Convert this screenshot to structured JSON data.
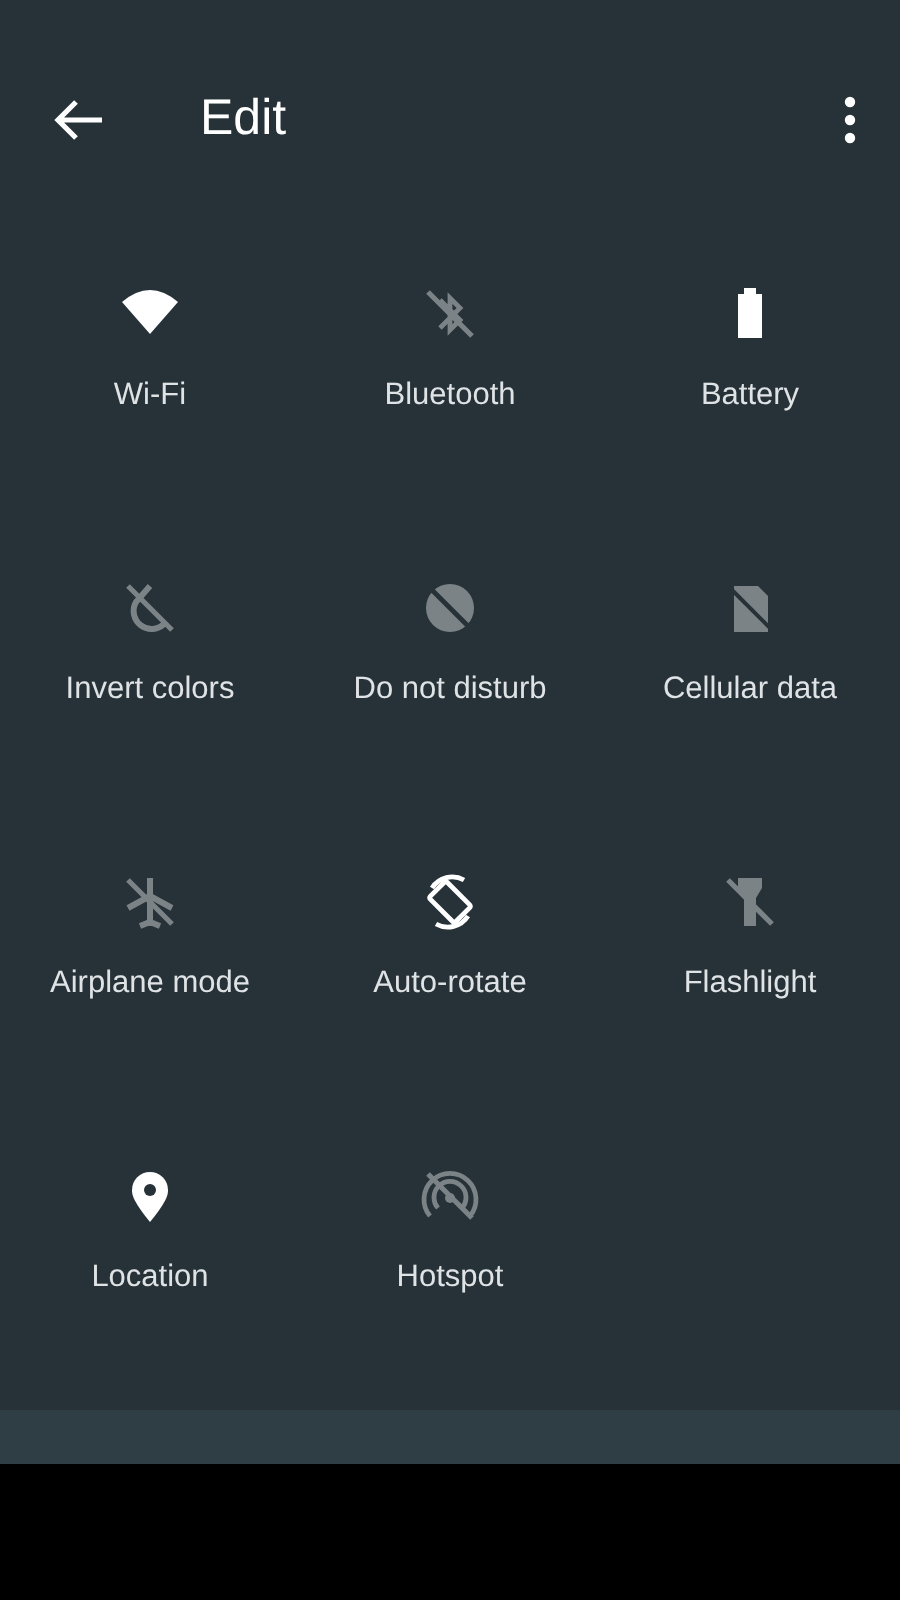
{
  "header": {
    "title": "Edit"
  },
  "tiles": [
    {
      "kind": "wifi",
      "label": "Wi-Fi",
      "on": true
    },
    {
      "kind": "bluetooth",
      "label": "Bluetooth",
      "on": false
    },
    {
      "kind": "battery",
      "label": "Battery",
      "on": true
    },
    {
      "kind": "invert",
      "label": "Invert colors",
      "on": false
    },
    {
      "kind": "dnd",
      "label": "Do not disturb",
      "on": false
    },
    {
      "kind": "cellular",
      "label": "Cellular data",
      "on": false
    },
    {
      "kind": "airplane",
      "label": "Airplane mode",
      "on": false
    },
    {
      "kind": "rotate",
      "label": "Auto-rotate",
      "on": true
    },
    {
      "kind": "flashlight",
      "label": "Flashlight",
      "on": false
    },
    {
      "kind": "location",
      "label": "Location",
      "on": true
    },
    {
      "kind": "hotspot",
      "label": "Hotspot",
      "on": false
    }
  ]
}
